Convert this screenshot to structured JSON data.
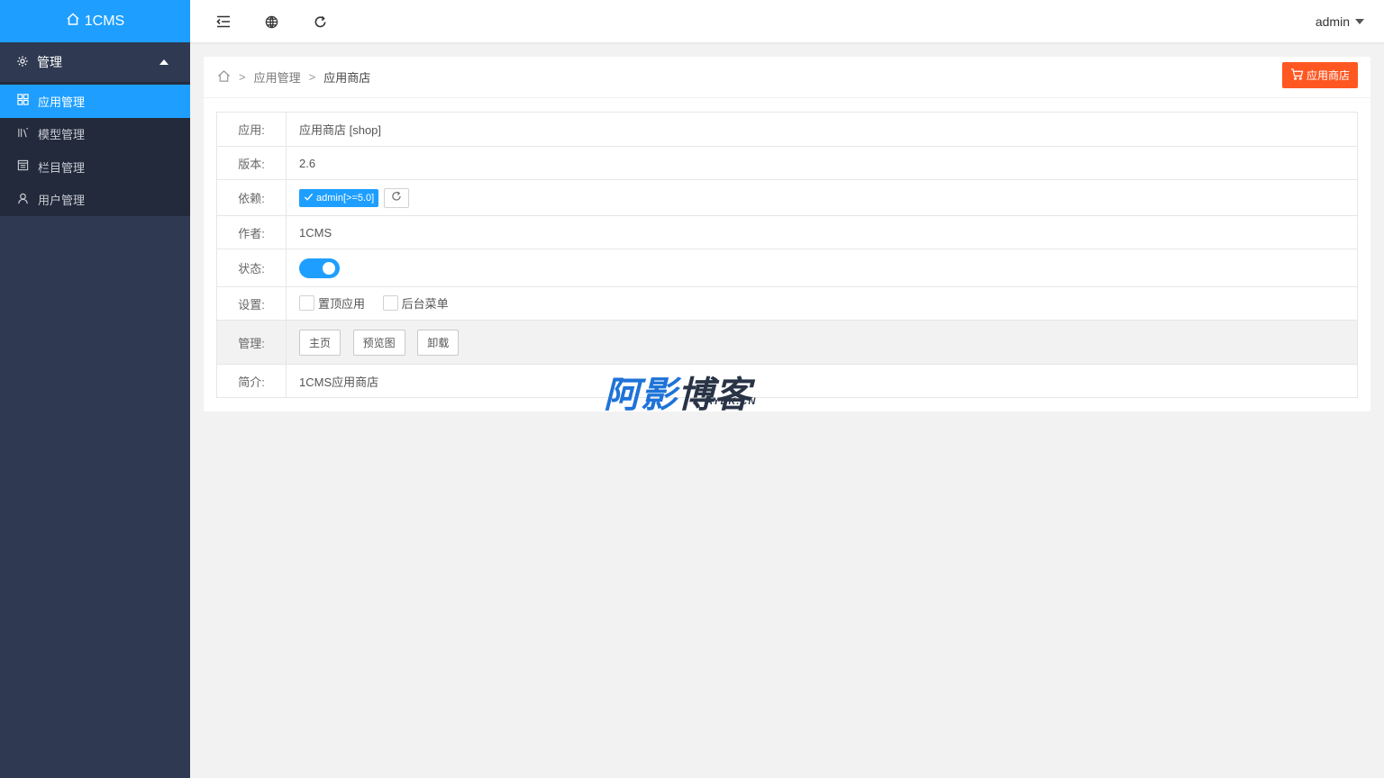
{
  "logo": {
    "text": "1CMS",
    "icon": "home-icon"
  },
  "sidebar": {
    "group": {
      "label": "管理",
      "icon": "gear-icon"
    },
    "items": [
      {
        "label": "应用管理",
        "icon": "apps-icon",
        "active": true
      },
      {
        "label": "模型管理",
        "icon": "model-icon",
        "active": false
      },
      {
        "label": "栏目管理",
        "icon": "column-icon",
        "active": false
      },
      {
        "label": "用户管理",
        "icon": "user-icon",
        "active": false
      }
    ]
  },
  "header": {
    "icons": [
      "menu-fold-icon",
      "globe-icon",
      "refresh-icon"
    ],
    "user": "admin"
  },
  "breadcrumb": {
    "sep": ">",
    "items": [
      "应用管理",
      "应用商店"
    ]
  },
  "shop_button": {
    "label": "应用商店",
    "color": "#ff5722"
  },
  "info": {
    "app": {
      "key": "应用:",
      "value": "应用商店 [shop]"
    },
    "version": {
      "key": "版本:",
      "value": "2.6"
    },
    "depends": {
      "key": "依赖:",
      "tag": "admin[>=5.0]"
    },
    "author": {
      "key": "作者:",
      "value": "1CMS"
    },
    "status": {
      "key": "状态:",
      "enabled": true
    },
    "settings": {
      "key": "设置:",
      "options": [
        "置顶应用",
        "后台菜单"
      ]
    },
    "manage": {
      "key": "管理:",
      "buttons": [
        "主页",
        "预览图",
        "卸载"
      ]
    },
    "intro": {
      "key": "简介:",
      "value": "1CMS应用商店"
    }
  },
  "watermark": {
    "cn_a": "阿影",
    "cn_b": "博客",
    "en": "AYBK.CN"
  },
  "colors": {
    "accent": "#1e9fff",
    "sidebar": "#2f3a52",
    "danger": "#ff5722"
  }
}
